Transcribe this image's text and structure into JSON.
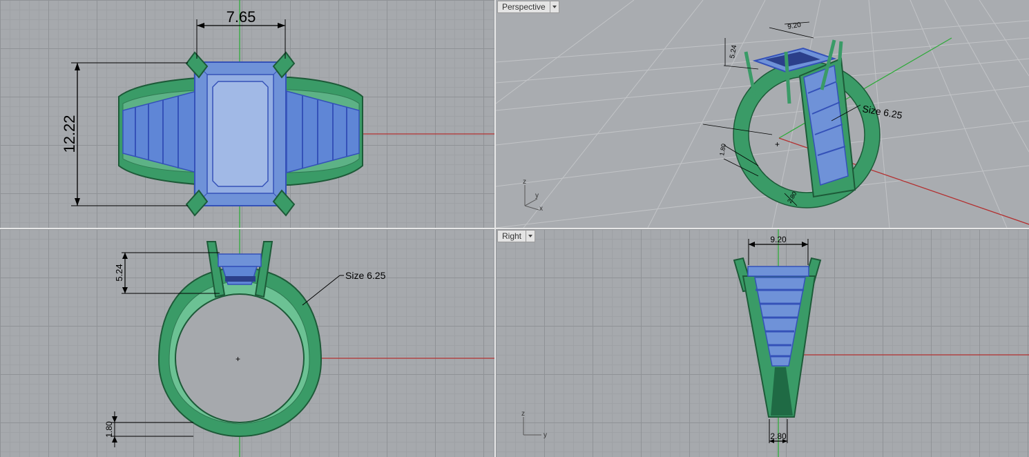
{
  "viewports": {
    "top": {
      "dim_width": "7.65",
      "dim_height": "12.22"
    },
    "perspective": {
      "label": "Perspective",
      "dim_width": "9.20",
      "dim_height": "5.24",
      "dim_ring": "Size 6.25",
      "dim_shank": "1.80",
      "dim_bottom": "2.80",
      "axis_z": "z",
      "axis_y": "y",
      "axis_x": "x"
    },
    "front": {
      "dim_height": "5.24",
      "dim_ring": "Size 6.25",
      "dim_shank": "1.80"
    },
    "right": {
      "label": "Right",
      "dim_width": "9.20",
      "dim_bottom": "2.80",
      "axis_z": "z",
      "axis_y": "y"
    }
  },
  "colors": {
    "metal": "#3a9b67",
    "metal_outline": "#1d5a38",
    "gem": "#6f92d8",
    "gem_outline": "#3451b8",
    "axis_x": "#b33030",
    "axis_y": "#2faa3a",
    "grid_bg": "#a6a9ad"
  }
}
